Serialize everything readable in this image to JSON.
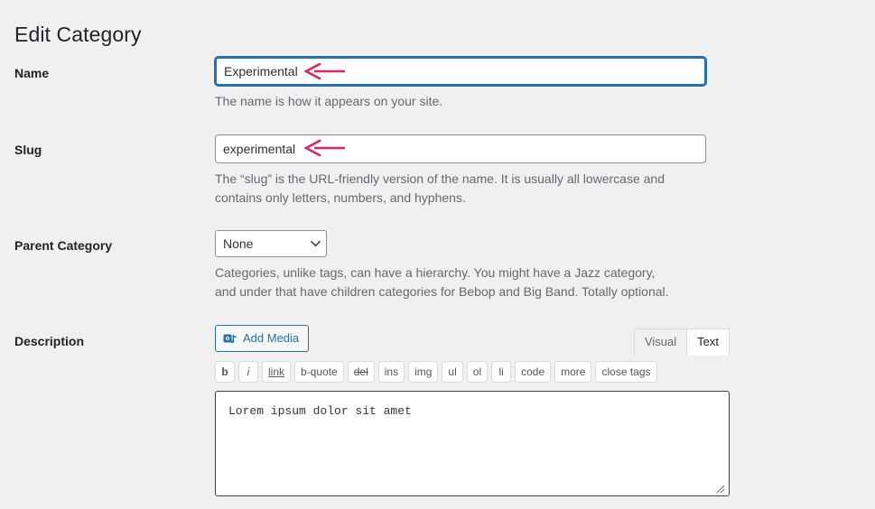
{
  "page": {
    "title": "Edit Category"
  },
  "fields": {
    "name": {
      "label": "Name",
      "value": "Experimental",
      "description": "The name is how it appears on your site."
    },
    "slug": {
      "label": "Slug",
      "value": "experimental",
      "description": "The “slug” is the URL-friendly version of the name. It is usually all lowercase and contains only letters, numbers, and hyphens."
    },
    "parent": {
      "label": "Parent Category",
      "value": "None",
      "options": [
        "None"
      ],
      "description": "Categories, unlike tags, can have a hierarchy. You might have a Jazz category, and under that have children categories for Bebop and Big Band. Totally optional."
    },
    "description": {
      "label": "Description"
    }
  },
  "editor": {
    "add_media_label": "Add Media",
    "add_media_icon": "media-icon",
    "tabs": [
      {
        "label": "Visual",
        "active": false
      },
      {
        "label": "Text",
        "active": true
      }
    ],
    "quicktags": [
      {
        "label": "b",
        "style": "bold"
      },
      {
        "label": "i",
        "style": "italic"
      },
      {
        "label": "link",
        "style": "underline"
      },
      {
        "label": "b-quote",
        "style": "none"
      },
      {
        "label": "del",
        "style": "strike"
      },
      {
        "label": "ins",
        "style": "none"
      },
      {
        "label": "img",
        "style": "none"
      },
      {
        "label": "ul",
        "style": "none"
      },
      {
        "label": "ol",
        "style": "none"
      },
      {
        "label": "li",
        "style": "none"
      },
      {
        "label": "code",
        "style": "none"
      },
      {
        "label": "more",
        "style": "none"
      },
      {
        "label": "close tags",
        "style": "none"
      }
    ],
    "content": "Lorem ipsum dolor sit amet"
  },
  "annotations": {
    "color": "#e0245e",
    "arrows": [
      {
        "name": "arrow-to-name-field",
        "target": "name"
      },
      {
        "name": "arrow-to-slug-field",
        "target": "slug"
      }
    ]
  },
  "colors": {
    "background": "#f0f0f1",
    "focus_border": "#2271b1",
    "text_primary": "#1d2327",
    "text_secondary": "#646970",
    "annotation": "#e0245e"
  }
}
